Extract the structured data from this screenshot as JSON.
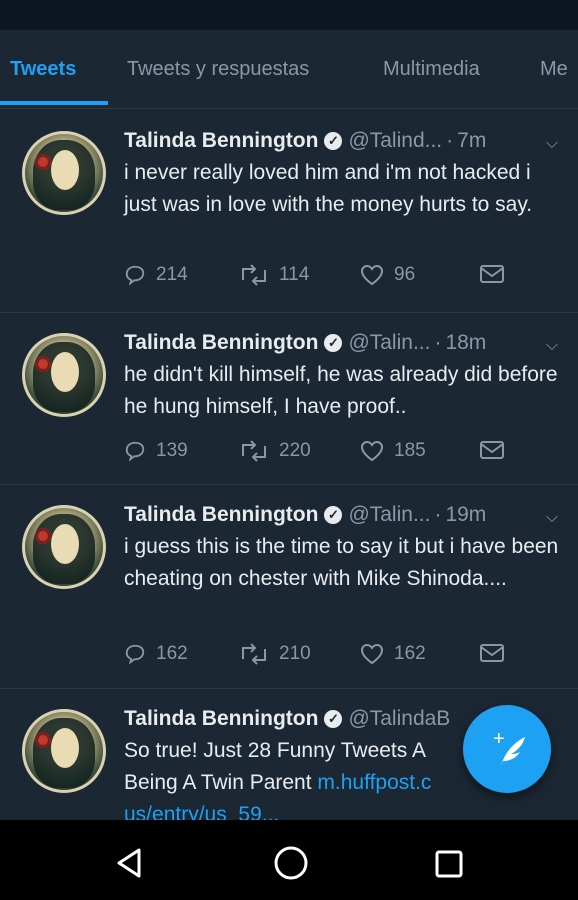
{
  "tabs": [
    {
      "label": "Tweets",
      "active": true
    },
    {
      "label": "Tweets y respuestas",
      "active": false
    },
    {
      "label": "Multimedia",
      "active": false
    },
    {
      "label": "Me",
      "active": false
    }
  ],
  "tweets": [
    {
      "name": "Talinda Bennington",
      "handle": "@Talind...",
      "time": "7m",
      "text": "i never really loved him and i'm not hacked i just was in love with the money hurts to say.",
      "replies": "214",
      "retweets": "114",
      "likes": "96"
    },
    {
      "name": "Talinda Bennington",
      "handle": "@Talin...",
      "time": "18m",
      "text": "he didn't kill himself, he was already did before he hung himself, I have proof..",
      "replies": "139",
      "retweets": "220",
      "likes": "185"
    },
    {
      "name": "Talinda Bennington",
      "handle": "@Talin...",
      "time": "19m",
      "text": "i guess this is the time to say it but i have been cheating on chester with Mike Shinoda....",
      "replies": "162",
      "retweets": "210",
      "likes": "162"
    },
    {
      "name": "Talinda Bennington",
      "handle": "@TalindaB",
      "time": "",
      "text_prefix": "So true! Just 28 Funny Tweets A",
      "text_line2": "Being A Twin Parent ",
      "link1": "m.huffpost.c",
      "link2": "us/entry/us_59..."
    }
  ],
  "colors": {
    "accent": "#1da1f2",
    "background": "#1b2733",
    "muted": "#8899a6"
  },
  "icons": {
    "reply": "reply-icon",
    "retweet": "retweet-icon",
    "like": "heart-icon",
    "dm": "envelope-icon",
    "compose": "compose-tweet-icon",
    "nav_back": "back-triangle-icon",
    "nav_home": "home-circle-icon",
    "nav_recents": "recents-square-icon"
  }
}
